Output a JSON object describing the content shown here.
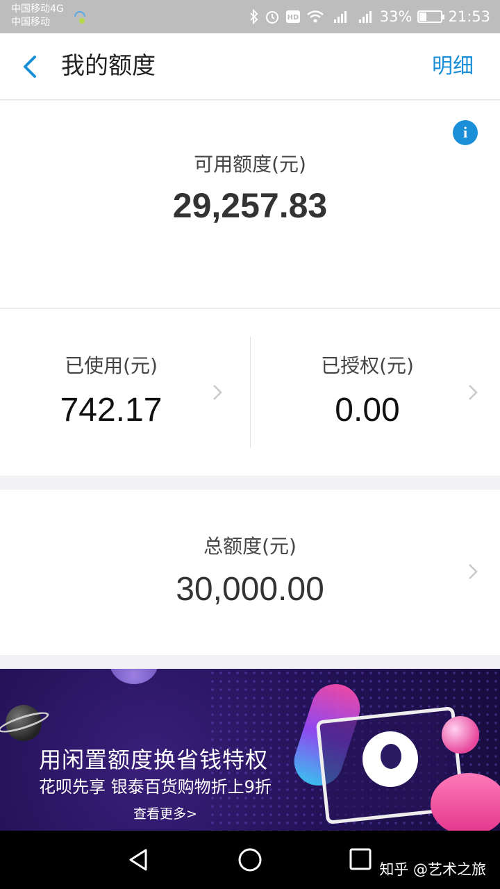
{
  "status_bar": {
    "carrier_1": "中国移动4G",
    "carrier_2": "中国移动",
    "battery": "33%",
    "battery_level": 0.33,
    "time": "21:53"
  },
  "nav": {
    "title": "我的额度",
    "detail_link": "明细"
  },
  "available": {
    "label": "可用额度(元)",
    "value": "29,257.83"
  },
  "used": {
    "label": "已使用(元)",
    "value": "742.17"
  },
  "authorized": {
    "label": "已授权(元)",
    "value": "0.00"
  },
  "total": {
    "label": "总额度(元)",
    "value": "30,000.00"
  },
  "banner": {
    "title": "用闲置额度换省钱特权",
    "subtitle": "花呗先享 银泰百货购物折上9折",
    "more": "查看更多>"
  },
  "watermark": "知乎 @艺术之旅",
  "colors": {
    "accent": "#1a8fd8",
    "banner_bg": "#24135a"
  }
}
